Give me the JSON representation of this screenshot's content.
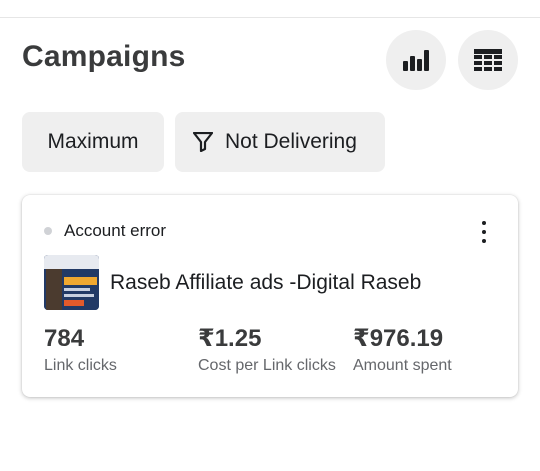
{
  "header": {
    "title": "Campaigns",
    "chart_button_icon": "bar-chart-icon",
    "table_button_icon": "table-icon"
  },
  "filters": {
    "maximum_label": "Maximum",
    "delivery_filter_label": "Not Delivering",
    "delivery_filter_icon": "filter-icon"
  },
  "campaign_card": {
    "status": "Account error",
    "status_color": "#d0d2d6",
    "name": "Raseb Affiliate ads -Digital Raseb",
    "more_icon": "more-vertical-icon",
    "metrics": [
      {
        "value": "784",
        "label": "Link clicks"
      },
      {
        "value": "₹1.25",
        "label": "Cost per Link clicks"
      },
      {
        "value": "₹976.19",
        "label": "Amount spent"
      }
    ]
  }
}
